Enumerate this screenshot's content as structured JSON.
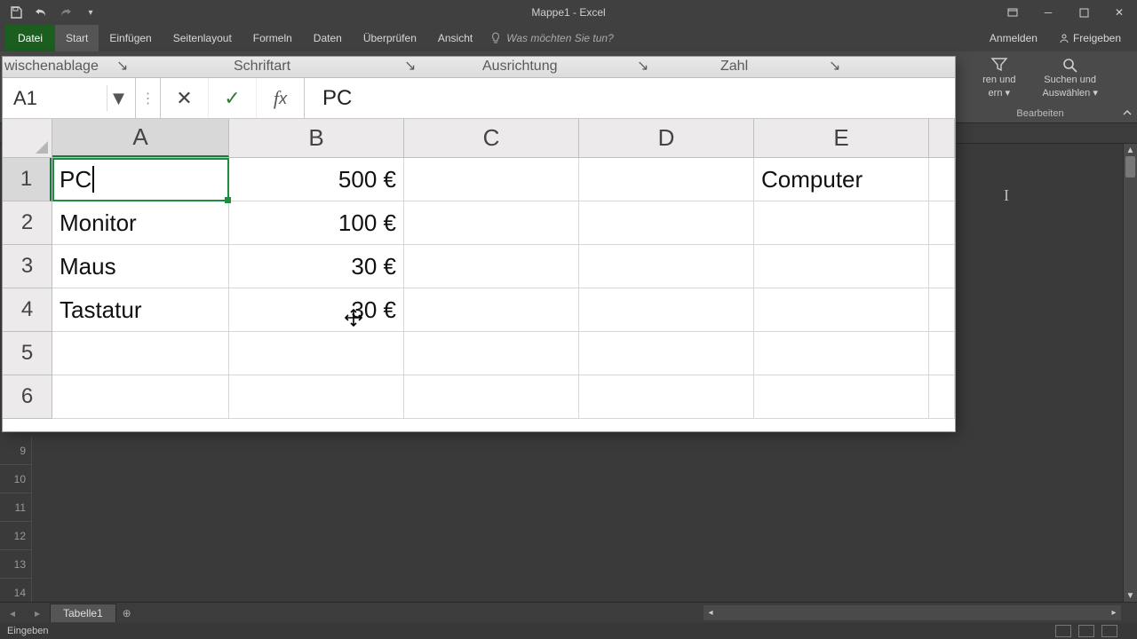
{
  "app": {
    "title": "Mappe1 - Excel",
    "status_mode": "Eingeben"
  },
  "qat": {
    "save": "save-icon",
    "undo": "undo-icon",
    "redo": "redo-icon",
    "customize": "customize-icon"
  },
  "ribbon": {
    "tabs": {
      "file": "Datei",
      "home": "Start",
      "insert": "Einfügen",
      "page_layout": "Seitenlayout",
      "formulas": "Formeln",
      "data": "Daten",
      "review": "Überprüfen",
      "view": "Ansicht"
    },
    "tell_me_placeholder": "Was möchten Sie tun?",
    "right": {
      "sign_in": "Anmelden",
      "share": "Freigeben"
    },
    "groups_fragment": {
      "clipboard": "wischenablage",
      "font": "Schriftart",
      "alignment": "Ausrichtung",
      "number": "Zahl"
    },
    "editing_group": {
      "sort_filter_top": "ren und",
      "sort_filter_bot": "ern ▾",
      "find_top": "Suchen und",
      "find_bot": "Auswählen ▾",
      "label": "Bearbeiten"
    }
  },
  "formula_bar": {
    "name_box": "A1",
    "value": "PC"
  },
  "grid": {
    "columns": [
      "A",
      "B",
      "C",
      "D",
      "E"
    ],
    "row_labels": [
      "1",
      "2",
      "3",
      "4",
      "5",
      "6"
    ],
    "bg_row_labels": [
      "9",
      "10",
      "11",
      "12",
      "13",
      "14"
    ],
    "rows": [
      {
        "A": "PC",
        "B": "500 €",
        "C": "",
        "D": "",
        "E": "Computer"
      },
      {
        "A": "Monitor",
        "B": "100 €",
        "C": "",
        "D": "",
        "E": ""
      },
      {
        "A": "Maus",
        "B": "30 €",
        "C": "",
        "D": "",
        "E": ""
      },
      {
        "A": "Tastatur",
        "B": "30 €",
        "C": "",
        "D": "",
        "E": ""
      },
      {
        "A": "",
        "B": "",
        "C": "",
        "D": "",
        "E": ""
      },
      {
        "A": "",
        "B": "",
        "C": "",
        "D": "",
        "E": ""
      }
    ],
    "active_cell": "A1"
  },
  "sheets": {
    "active": "Tabelle1"
  },
  "colors": {
    "excel_green": "#217346"
  }
}
